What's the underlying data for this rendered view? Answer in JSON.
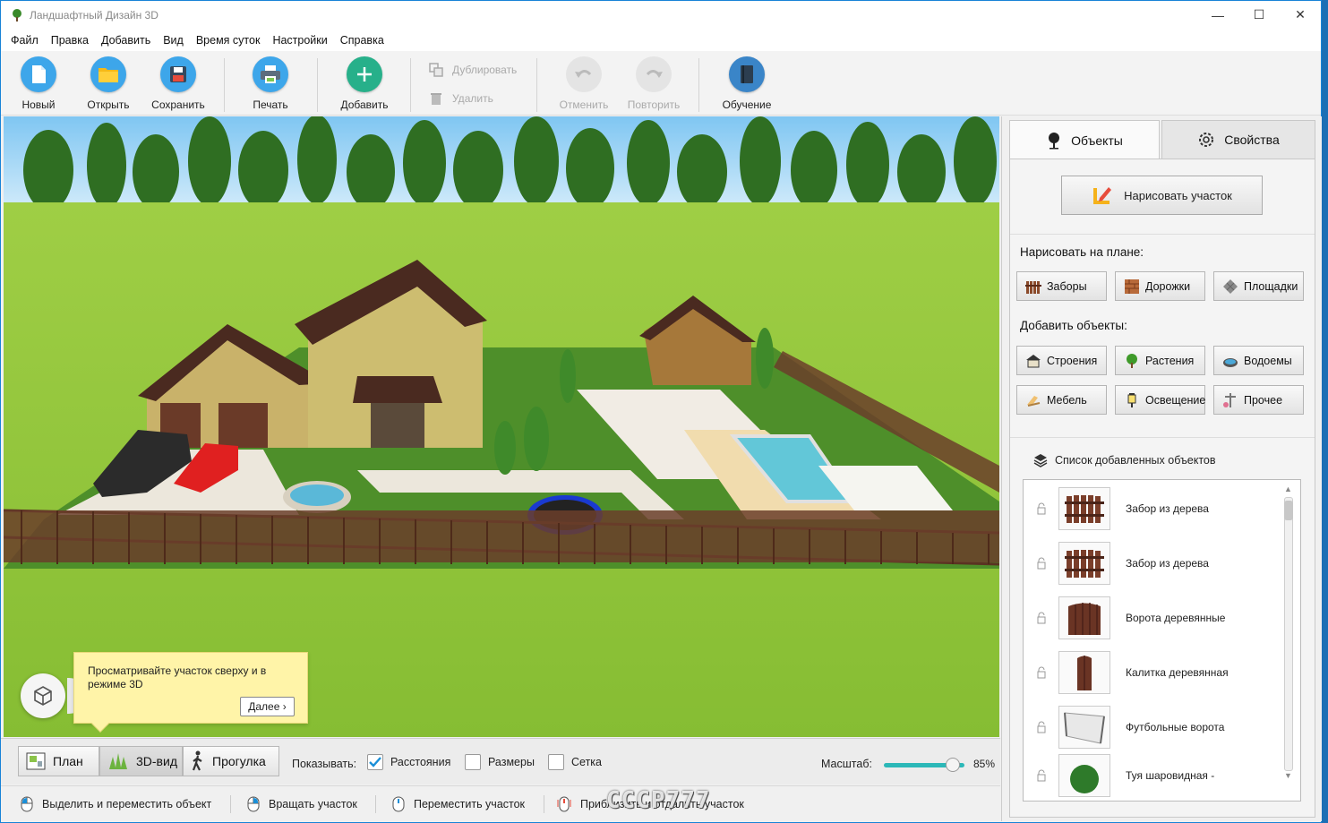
{
  "window": {
    "title": "Ландшафтный Дизайн 3D",
    "minimize": "—",
    "maximize": "☐",
    "close": "✕"
  },
  "menu": [
    "Файл",
    "Правка",
    "Добавить",
    "Вид",
    "Время суток",
    "Настройки",
    "Справка"
  ],
  "toolbar": {
    "new": "Новый",
    "open": "Открыть",
    "save": "Сохранить",
    "print": "Печать",
    "add": "Добавить",
    "duplicate": "Дублировать",
    "delete": "Удалить",
    "undo": "Отменить",
    "redo": "Повторить",
    "tutorial": "Обучение"
  },
  "onboarding": {
    "text": "Просматривайте участок сверху и в режиме 3D",
    "next": "Далее ›"
  },
  "viewbar": {
    "modes": [
      "План",
      "3D-вид",
      "Прогулка"
    ],
    "active_mode": "3D-вид",
    "show_label": "Показывать:",
    "checkboxes": [
      {
        "label": "Расстояния",
        "checked": true
      },
      {
        "label": "Размеры",
        "checked": false
      },
      {
        "label": "Сетка",
        "checked": false
      }
    ],
    "scale_label": "Масштаб:",
    "scale_value": "85%",
    "scale_fraction": 0.85
  },
  "statusbar": [
    "Выделить и переместить объект",
    "Вращать участок",
    "Переместить участок",
    "Приблизить и отдалить участок"
  ],
  "watermark": "CCCP777",
  "panel": {
    "tabs": [
      "Объекты",
      "Свойства"
    ],
    "draw_plot": "Нарисовать участок",
    "draw_on_plan": "Нарисовать на плане:",
    "draw_buttons": [
      "Заборы",
      "Дорожки",
      "Площадки"
    ],
    "add_objects": "Добавить объекты:",
    "add_buttons": [
      "Строения",
      "Растения",
      "Водоемы",
      "Мебель",
      "Освещение",
      "Прочее"
    ],
    "list_title": "Список добавленных объектов",
    "objects": [
      "Забор из дерева",
      "Забор из дерева",
      "Ворота деревянные",
      "Калитка деревянная",
      "Футбольные ворота",
      "Туя шаровидная -"
    ]
  },
  "colors": {
    "accent": "#2cb8b8",
    "new_btn": "#3da6ea",
    "open_btn": "#3da6ea",
    "add_btn": "#27b08a",
    "tutorial_btn": "#3a85c8",
    "grass": "#8dc43a"
  }
}
